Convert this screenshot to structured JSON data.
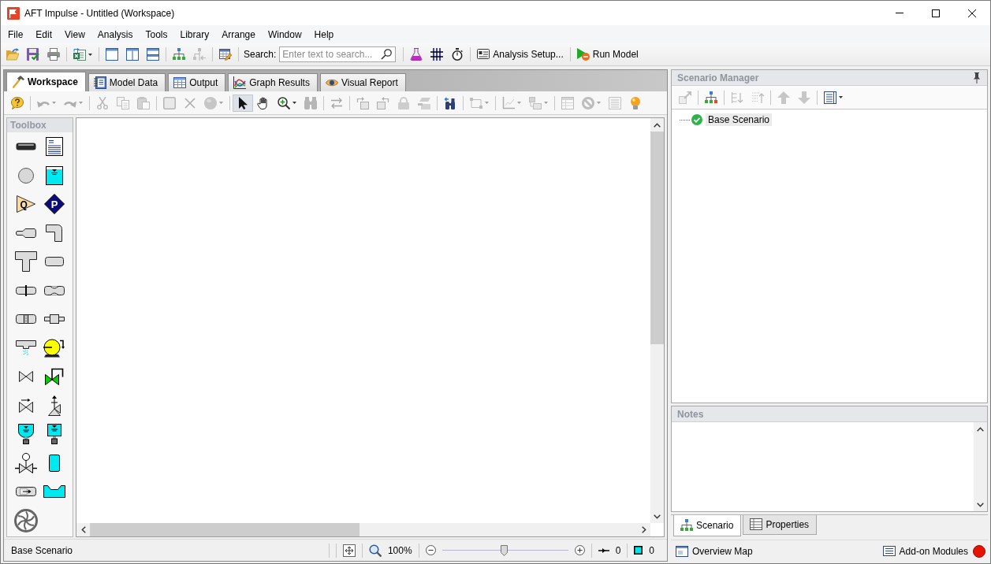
{
  "window": {
    "title": "AFT Impulse - Untitled (Workspace)"
  },
  "menu": [
    "File",
    "Edit",
    "View",
    "Analysis",
    "Tools",
    "Library",
    "Arrange",
    "Window",
    "Help"
  ],
  "toolbar": {
    "groups": [
      [
        {
          "kind": "tool",
          "disabled": false
        },
        {
          "kind": "tool",
          "disabled": false
        },
        {
          "kind": "tool",
          "disabled": false
        }
      ],
      [
        {
          "kind": "tool",
          "disabled": false
        }
      ],
      [
        {
          "kind": "tool",
          "disabled": false
        },
        {
          "kind": "tool",
          "disabled": false
        },
        {
          "kind": "tool",
          "disabled": false
        }
      ],
      [
        {
          "kind": "tool",
          "disabled": false
        },
        {
          "kind": "tool",
          "disabled": true
        }
      ],
      [
        {
          "kind": "tool",
          "disabled": false
        }
      ],
      [
        {
          "kind": "search",
          "label": "Search:",
          "placeholder": "Enter text to search..."
        }
      ],
      [
        {
          "kind": "tool",
          "disabled": false
        },
        {
          "kind": "tool",
          "disabled": false
        },
        {
          "kind": "tool",
          "disabled": false
        }
      ],
      [
        {
          "kind": "button",
          "label": "Analysis Setup..."
        }
      ],
      [
        {
          "kind": "button",
          "label": "Run Model"
        }
      ]
    ]
  },
  "tabs": [
    {
      "label": "Workspace",
      "selected": true
    },
    {
      "label": "Model Data",
      "selected": false
    },
    {
      "label": "Output",
      "selected": false
    },
    {
      "label": "Graph Results",
      "selected": false
    },
    {
      "label": "Visual Report",
      "selected": false
    }
  ],
  "workspace_toolbar": {
    "groups": [
      [
        {
          "kind": "tool",
          "disabled": false
        }
      ],
      [
        {
          "kind": "tool",
          "disabled": true
        },
        {
          "kind": "tool",
          "disabled": true
        }
      ],
      [
        {
          "kind": "tool",
          "disabled": true
        },
        {
          "kind": "tool",
          "disabled": true
        },
        {
          "kind": "tool",
          "disabled": true
        }
      ],
      [
        {
          "kind": "tool",
          "disabled": true
        },
        {
          "kind": "tool",
          "disabled": true
        },
        {
          "kind": "tool",
          "disabled": true
        }
      ],
      [
        {
          "kind": "tool",
          "disabled": false,
          "selected": true
        },
        {
          "kind": "tool",
          "disabled": false,
          "selected": false
        },
        {
          "kind": "tool",
          "disabled": false,
          "selected": false
        },
        {
          "kind": "tool",
          "disabled": true,
          "selected": false
        }
      ],
      [
        {
          "kind": "tool",
          "disabled": true
        }
      ],
      [
        {
          "kind": "tool",
          "disabled": true
        },
        {
          "kind": "tool",
          "disabled": true
        },
        {
          "kind": "tool",
          "disabled": true
        },
        {
          "kind": "tool",
          "disabled": true
        }
      ],
      [
        {
          "kind": "tool",
          "disabled": false
        }
      ],
      [
        {
          "kind": "tool",
          "disabled": true
        }
      ],
      [
        {
          "kind": "tool",
          "disabled": true
        },
        {
          "kind": "tool",
          "disabled": true
        }
      ],
      [
        {
          "kind": "tool",
          "disabled": true
        },
        {
          "kind": "tool",
          "disabled": true
        },
        {
          "kind": "tool",
          "disabled": true
        },
        {
          "kind": "tool",
          "disabled": false
        }
      ]
    ]
  },
  "toolbox": {
    "title": "Toolbox",
    "triangle_letter": "Q",
    "diamond_letter": "P"
  },
  "scenario_manager": {
    "title": "Scenario Manager",
    "toolbar": {
      "groups": [
        [
          {
            "kind": "tool",
            "disabled": true
          }
        ],
        [
          {
            "kind": "tool",
            "disabled": false
          }
        ],
        [
          {
            "kind": "tool",
            "disabled": true
          },
          {
            "kind": "tool",
            "disabled": true
          }
        ],
        [
          {
            "kind": "tool",
            "disabled": true
          },
          {
            "kind": "tool",
            "disabled": true
          }
        ],
        [
          {
            "kind": "tool",
            "disabled": false
          }
        ]
      ]
    },
    "tree": [
      {
        "label": "Base Scenario",
        "selected": true
      }
    ]
  },
  "notes": {
    "title": "Notes"
  },
  "bottom_tabs": [
    {
      "label": "Scenario",
      "selected": true
    },
    {
      "label": "Properties",
      "selected": false
    }
  ],
  "status_bar": {
    "scenario": "Base Scenario",
    "zoom": "100%",
    "zoom_slider": {
      "level": 0.49
    },
    "counts": [
      "0",
      "0"
    ]
  },
  "right_status_bar": {
    "buttons": [
      "Overview Map",
      "Add-on Modules"
    ]
  }
}
